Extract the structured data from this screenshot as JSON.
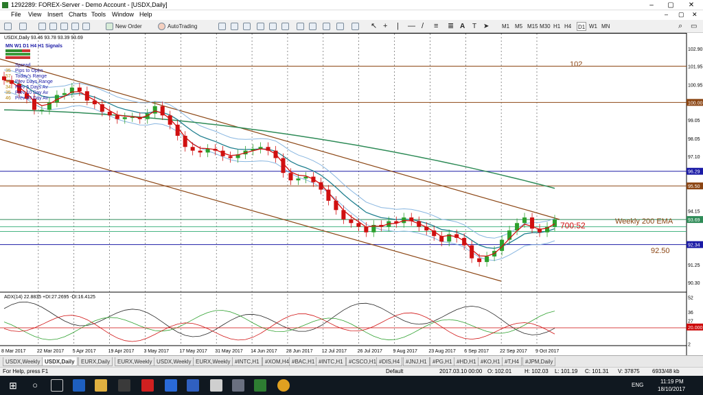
{
  "window": {
    "title": "1292289: FOREX-Server - Demo Account - [USDX,Daily]"
  },
  "menu": [
    "File",
    "View",
    "Insert",
    "Charts",
    "Tools",
    "Window",
    "Help"
  ],
  "toolbar": {
    "new_order": "New Order",
    "autotrading": "AutoTrading",
    "timeframes": [
      "M1",
      "M5",
      "M15",
      "M30",
      "H1",
      "H4",
      "D1",
      "W1",
      "MN"
    ]
  },
  "chart_data": {
    "type": "line",
    "symbol_header": "USDX,Daily  93.46 93.78 93.39 93.69",
    "price_axis_ticks": [
      "102.90",
      "101.95",
      "100.95",
      "100.00",
      "99.05",
      "98.05",
      "97.10",
      "96.29",
      "95.50",
      "94.15",
      "93.69",
      "92.34",
      "91.25",
      "90.30"
    ],
    "price_range": [
      90.0,
      103.3
    ],
    "date_ticks": [
      "8 Mar 2017",
      "22 Mar 2017",
      "5 Apr 2017",
      "19 Apr 2017",
      "3 May 2017",
      "17 May 2017",
      "31 May 2017",
      "14 Jun 2017",
      "28 Jun 2017",
      "12 Jul 2017",
      "26 Jul 2017",
      "9 Aug 2017",
      "23 Aug 2017",
      "6 Sep 2017",
      "22 Sep 2017",
      "9 Oct 2017"
    ],
    "price_series": [
      101.2,
      101.0,
      100.5,
      100.2,
      99.6,
      99.6,
      100.0,
      100.4,
      100.5,
      100.8,
      100.6,
      100.1,
      99.9,
      99.5,
      99.3,
      99.1,
      99.2,
      99.2,
      99.1,
      99.4,
      99.8,
      99.3,
      98.8,
      98.2,
      97.6,
      97.4,
      97.3,
      97.5,
      97.4,
      97.1,
      97.0,
      97.2,
      97.4,
      97.5,
      97.6,
      97.4,
      97.0,
      96.2,
      95.8,
      95.9,
      96.0,
      95.7,
      95.3,
      94.7,
      94.2,
      93.7,
      93.5,
      93.3,
      93.0,
      93.4,
      93.3,
      93.6,
      93.5,
      93.8,
      93.6,
      93.3,
      93.1,
      92.8,
      92.5,
      92.9,
      92.7,
      92.3,
      91.6,
      91.4,
      91.7,
      92.0,
      92.6,
      93.1,
      93.5,
      93.8,
      93.2,
      93.0,
      93.3,
      93.69
    ],
    "horizontal_levels": [
      {
        "label": "102",
        "value": 101.95
      },
      {
        "label": "100.00",
        "value": 100.0
      },
      {
        "label": "96.29",
        "value": 96.29
      },
      {
        "label": "95.50",
        "value": 95.5
      },
      {
        "label": "93.69",
        "value": 93.69
      },
      {
        "label": "92.34",
        "value": 92.34
      }
    ],
    "annotations": [
      "102",
      "700:52",
      "Weekly 200 EMA",
      "92.50"
    ],
    "adx_header": "ADX(14) 22.8835 +DI:27.2695 -DI:16.4125",
    "adx_ticks": [
      "52",
      "36",
      "27",
      "20.000",
      "2"
    ],
    "adx_range": [
      0,
      56
    ]
  },
  "info_panel": {
    "signals_title": "MN W1 D1  H4  H1  Signals",
    "rows": [
      {
        "n": "",
        "t": "Spread"
      },
      {
        "n": "35",
        "t": "Pips to Open"
      },
      {
        "n": "57",
        "t": "Today's Range"
      },
      {
        "n": "45",
        "t": "Prev Days Range"
      },
      {
        "n": "34",
        "t": "Prev 5 Days Av"
      },
      {
        "n": "35",
        "t": "Prev 10 Day Av"
      },
      {
        "n": "46",
        "t": "Prev 20 Day Av"
      }
    ]
  },
  "tabs": [
    "USDX,Weekly",
    "USDX,Daily",
    "EURX,Daily",
    "EURX,Weekly",
    "USDX,Weekly",
    "EURX,Weekly",
    "#INTC,H1",
    "#XOM,H4",
    "#BAC,H1",
    "#INTC,H1",
    "#CSCO,H1",
    "#DIS,H4",
    "#JNJ,H1",
    "#PG,H1",
    "#HD,H1",
    "#KO,H1",
    "#T,H4",
    "#JPM,Daily"
  ],
  "status": {
    "help": "For Help, press F1",
    "profile": "Default",
    "datetime": "2017.03.10 00:00",
    "open": "O: 102.01",
    "high": "H: 102.03",
    "low": "L: 101.19",
    "close": "C: 101.31",
    "volume": "V: 37875",
    "traffic": "6933/48 kb"
  },
  "taskbar": {
    "lang": "ENG",
    "time": "11:19 PM",
    "date": "18/10/2017"
  },
  "colors": {
    "accent": "#8B4513",
    "blue_line": "#1a1aa6",
    "green_line": "#2e8b57",
    "ema_red": "#d01010"
  }
}
